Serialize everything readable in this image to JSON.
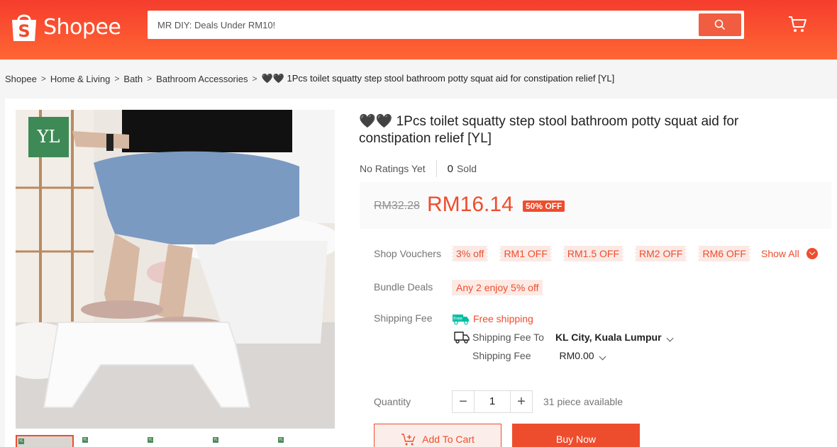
{
  "header": {
    "logo_text": "Shopee",
    "search_placeholder": "MR DIY: Deals Under RM10!",
    "brand_color": "#ee4d2d"
  },
  "breadcrumb": {
    "items": [
      "Shopee",
      "Home & Living",
      "Bath",
      "Bathroom Accessories"
    ],
    "current": "🖤🖤 1Pcs toilet squatty step stool bathroom potty squat aid for constipation relief [YL]"
  },
  "product": {
    "image_badge": "YL",
    "title": "🖤🖤 1Pcs toilet squatty step stool bathroom potty squat aid for constipation relief [YL]",
    "ratings_text": "No Ratings Yet",
    "sold_count": "0",
    "sold_label": "Sold",
    "old_price": "RM32.28",
    "price": "RM16.14",
    "discount_badge": "50% OFF"
  },
  "vouchers": {
    "label": "Shop Vouchers",
    "items": [
      "3% off",
      "RM1 OFF",
      "RM1.5 OFF",
      "RM2 OFF",
      "RM6 OFF"
    ],
    "show_all": "Show All"
  },
  "bundle": {
    "label": "Bundle Deals",
    "value": "Any 2 enjoy 5% off"
  },
  "shipping": {
    "label": "Shipping Fee",
    "free_badge": "Free",
    "free_text": "Free shipping",
    "to_label": "Shipping Fee To",
    "location": "KL City, Kuala Lumpur",
    "fee_label": "Shipping Fee",
    "fee_value": "RM0.00"
  },
  "quantity": {
    "label": "Quantity",
    "minus": "−",
    "value": "1",
    "plus": "+",
    "available": "31 piece available"
  },
  "actions": {
    "add_to_cart": "Add To Cart",
    "buy_now": "Buy Now"
  },
  "thumbnails": {
    "badge": "YL"
  }
}
